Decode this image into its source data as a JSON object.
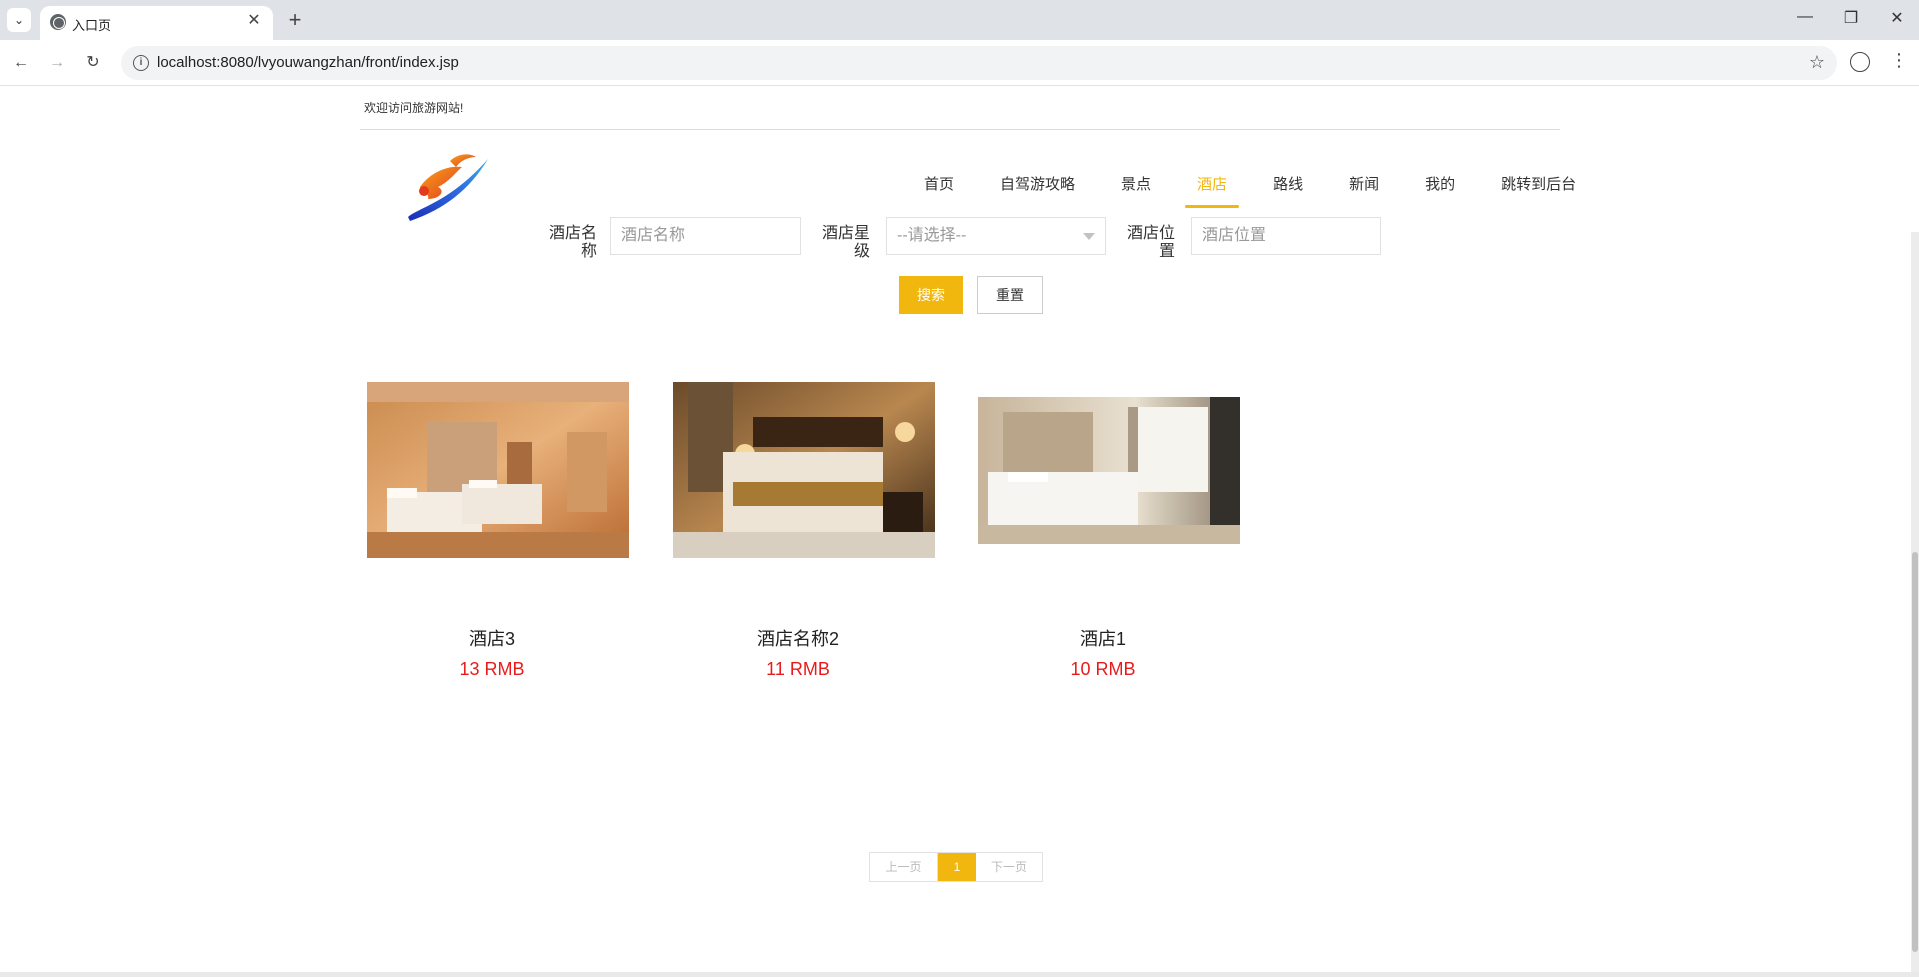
{
  "browser": {
    "tab_title": "入口页",
    "url": "localhost:8080/lvyouwangzhan/front/index.jsp"
  },
  "header": {
    "welcome": "欢迎访问旅游网站!"
  },
  "nav": {
    "items": [
      "首页",
      "自驾游攻略",
      "景点",
      "酒店",
      "路线",
      "新闻",
      "我的",
      "跳转到后台"
    ],
    "active": "酒店"
  },
  "search": {
    "name_label": "酒店名称",
    "name_placeholder": "酒店名称",
    "star_label": "酒店星级",
    "star_selected": "--请选择--",
    "location_label": "酒店位置",
    "location_placeholder": "酒店位置",
    "search_button": "搜索",
    "reset_button": "重置"
  },
  "hotels": [
    {
      "name": "酒店3",
      "price": "13 RMB"
    },
    {
      "name": "酒店名称2",
      "price": "11 RMB"
    },
    {
      "name": "酒店1",
      "price": "10 RMB"
    }
  ],
  "pagination": {
    "prev": "上一页",
    "current": "1",
    "next": "下一页"
  },
  "colors": {
    "accent": "#f2b70f",
    "price": "#e81b1b"
  }
}
